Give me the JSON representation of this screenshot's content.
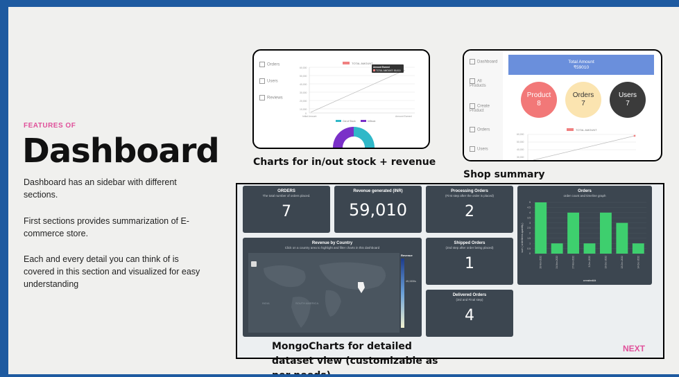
{
  "slide": {
    "kicker": "FEATURES OF",
    "title": "Dashboard",
    "paragraphs": [
      "Dashboard has an sidebar with different sections.",
      "First sections provides summarization of E- commerce  store.",
      "Each and every detail you can think of is covered in this section and visualized for easy understanding"
    ],
    "next": "NEXT"
  },
  "captions": {
    "charts": "Charts for in/out stock + revenue",
    "shop": "Shop summary",
    "mongo": "MongoCharts for detailed dataset view (customizable as per needs)"
  },
  "shot1": {
    "sidebar": [
      "Orders",
      "Users",
      "Reviews"
    ],
    "legend": "TOTAL AMOUNT",
    "tooltip_title": "Amount Earned",
    "tooltip_value": "TOTAL AMOUNT: 59,010",
    "ticks": [
      "60,000",
      "50,000",
      "40,000",
      "30,000",
      "20,000",
      "10,000",
      "0"
    ],
    "xlabels": [
      "Initial Amount",
      "Amount Earned"
    ],
    "donut_legend": [
      "Out of Stock",
      "InStock"
    ],
    "colors": {
      "line": "#f08080",
      "instock": "#30b8c8",
      "outstock": "#7a30c8"
    }
  },
  "shot2": {
    "sidebar": [
      "Dashboard",
      "All Products",
      "Create Product",
      "Orders",
      "Users"
    ],
    "total_label": "Total Amount",
    "total_value": "₹59010",
    "circles": [
      {
        "label": "Product",
        "value": "8",
        "color": "#f27878"
      },
      {
        "label": "Orders",
        "value": "7",
        "color": "#fbe4b0"
      },
      {
        "label": "Users",
        "value": "7",
        "color": "#3b3b3b"
      }
    ],
    "legend": "TOTAL AMOUNT",
    "ticks": [
      "60,000",
      "50,000",
      "40,000",
      "30,000"
    ]
  },
  "mongo": {
    "orders": {
      "title": "ORDERS",
      "sub": "The total number of orders placed.",
      "value": "7"
    },
    "revenue": {
      "title": "Revenue generated (INR)",
      "value": "59,010"
    },
    "processing": {
      "title": "Processing Orders",
      "sub": "(First step after the order is placed)",
      "value": "2"
    },
    "shipped": {
      "title": "Shipped Orders",
      "sub": "(2nd step after order being placed)",
      "value": "1"
    },
    "delivered": {
      "title": "Delivered Orders",
      "sub": "(3rd and Final step)",
      "value": "4"
    },
    "map": {
      "title": "Revenue by Country",
      "sub": "Click on a country area to highlight and filter charts in this dashboard",
      "legend_title": "Revenue",
      "legend_value": "49,1530s",
      "labels": [
        "SOUTH AMERICA",
        "INDIA"
      ]
    },
    "bar": {
      "title": "Orders",
      "sub": "order count and timeline graph",
      "ylabel": "sum ( orderItems.quantity )",
      "xlabel": "createdAt",
      "categories": [
        "20-Nov-2022",
        "24-Nov-2022",
        "27-Nov-2022",
        "3-Dec-2022",
        "13-Dec-2022",
        "13-Dec-2022",
        "14-Dec-2022"
      ],
      "values": [
        5,
        1,
        4,
        1,
        4,
        3,
        1
      ],
      "ylim": [
        0,
        5
      ],
      "ticks": [
        "5",
        "4.5",
        "4",
        "3.5",
        "3",
        "2.5",
        "2",
        "1.5",
        "1",
        "0.5",
        "0"
      ],
      "color": "#3ecf6e"
    }
  },
  "chart_data": {
    "type": "bar",
    "title": "Orders",
    "subtitle": "order count and timeline graph",
    "xlabel": "createdAt",
    "ylabel": "sum ( orderItems.quantity )",
    "categories": [
      "20-Nov-2022",
      "24-Nov-2022",
      "27-Nov-2022",
      "3-Dec-2022",
      "13-Dec-2022",
      "13-Dec-2022",
      "14-Dec-2022"
    ],
    "values": [
      5,
      1,
      4,
      1,
      4,
      3,
      1
    ],
    "ylim": [
      0,
      5
    ],
    "grid": true
  }
}
